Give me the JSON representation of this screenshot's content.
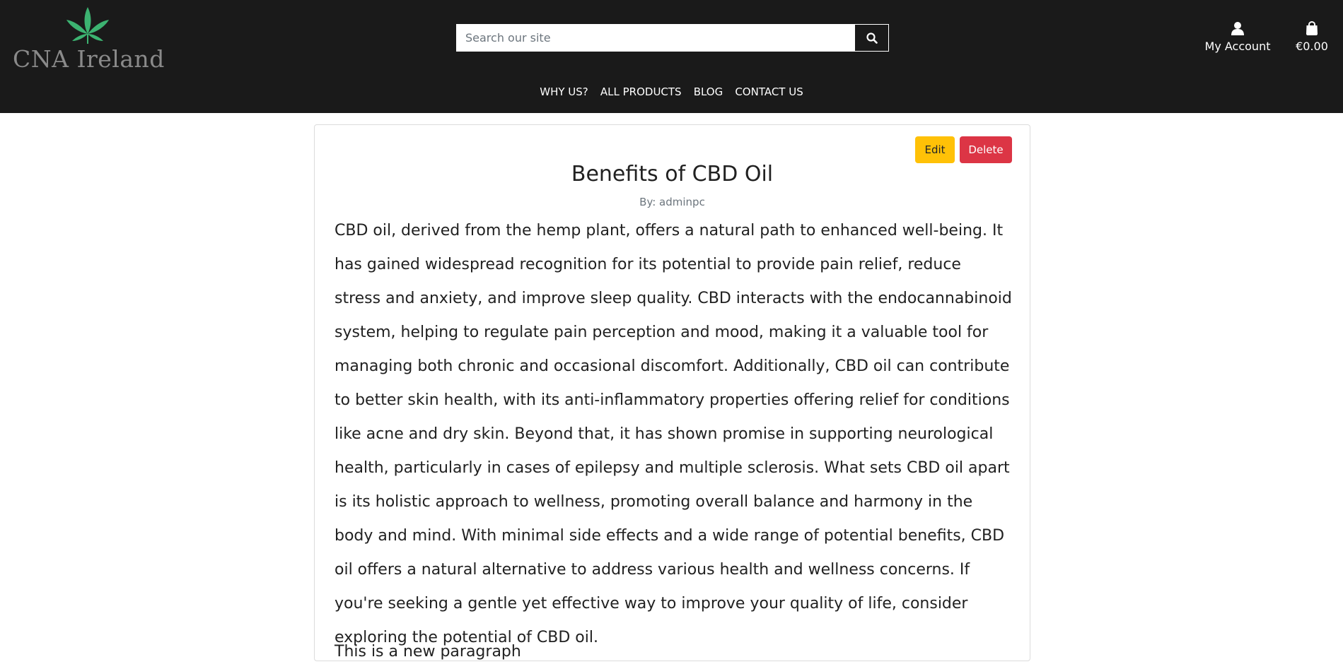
{
  "header": {
    "logo_text": "CNA Ireland",
    "search": {
      "placeholder": "Search our site",
      "value": ""
    },
    "account_label": "My Account",
    "bag_total": "€0.00",
    "icons": {
      "logo": "cannabis-leaf-icon",
      "search": "search-icon",
      "account": "user-icon",
      "bag": "shopping-bag-icon"
    }
  },
  "nav": {
    "items": [
      {
        "label": "WHY US?"
      },
      {
        "label": "ALL PRODUCTS"
      },
      {
        "label": "BLOG"
      },
      {
        "label": "CONTACT US"
      }
    ]
  },
  "post": {
    "edit_label": "Edit",
    "delete_label": "Delete",
    "title": "Benefits of CBD Oil",
    "author": "By: adminpc",
    "body": "CBD oil, derived from the hemp plant, offers a natural path to enhanced well-being. It has gained widespread recognition for its potential to provide pain relief, reduce stress and anxiety, and improve sleep quality. CBD interacts with the endocannabinoid system, helping to regulate pain perception and mood, making it a valuable tool for managing both chronic and occasional discomfort. Additionally, CBD oil can contribute to better skin health, with its anti-inflammatory properties offering relief for conditions like acne and dry skin. Beyond that, it has shown promise in supporting neurological health, particularly in cases of epilepsy and multiple sclerosis. What sets CBD oil apart is its holistic approach to wellness, promoting overall balance and harmony in the body and mind. With minimal side effects and a wide range of potential benefits, CBD oil offers a natural alternative to address various health and wellness concerns. If you're seeking a gentle yet effective way to improve your quality of life, consider exploring the potential of CBD oil.",
    "body_second": "This is a new paragraph"
  },
  "colors": {
    "header_bg": "#1a1a1a",
    "logo_leaf": "#3cb371",
    "edit_button": "#ffc107",
    "delete_button": "#dc3545"
  }
}
